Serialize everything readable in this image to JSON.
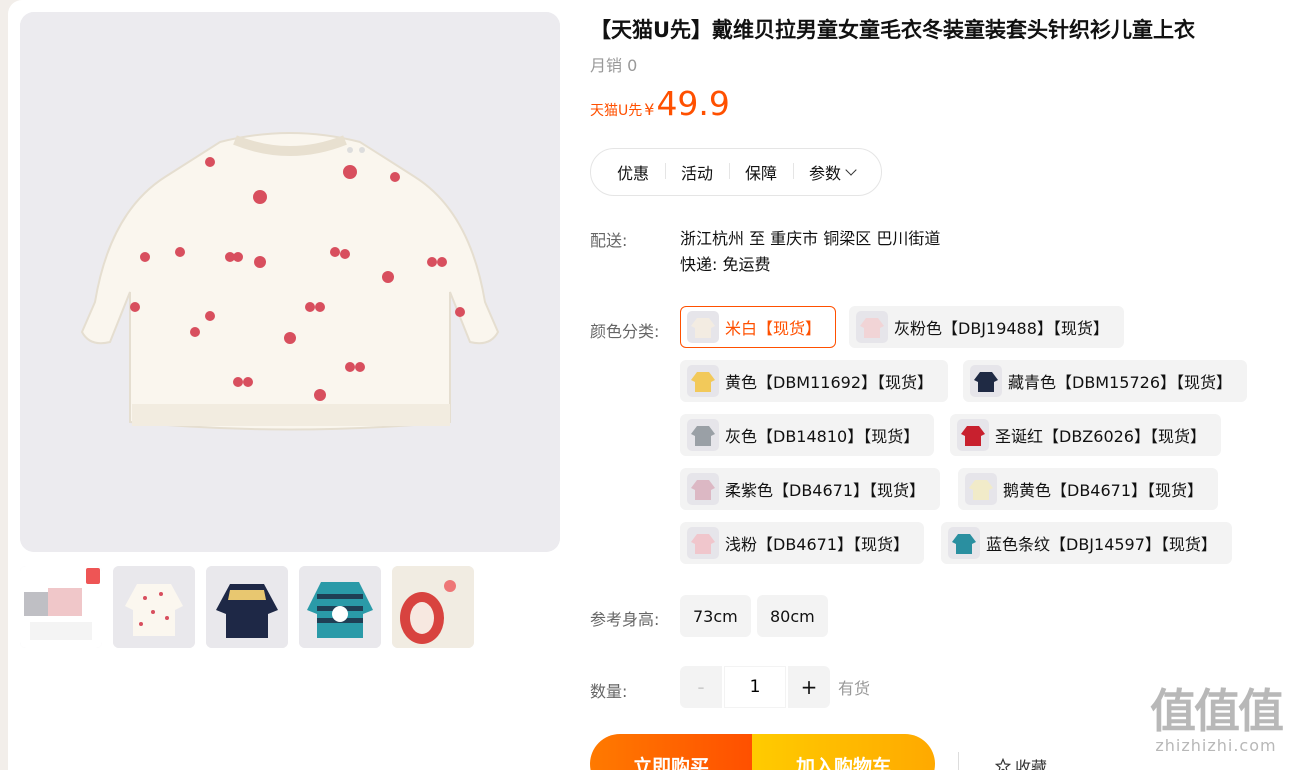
{
  "product": {
    "title": "【天猫U先】戴维贝拉男童女童毛衣冬装童装套头针织衫儿童上衣",
    "sales": "月销 0",
    "price_tag": "天猫U先",
    "currency": "¥",
    "price": "49.9"
  },
  "tabs": [
    {
      "label": "优惠"
    },
    {
      "label": "活动"
    },
    {
      "label": "保障"
    },
    {
      "label": "参数"
    }
  ],
  "shipping": {
    "label": "配送:",
    "route": "浙江杭州 至 重庆市 铜梁区 巴川街道",
    "express": "快递: 免运费"
  },
  "color": {
    "label": "颜色分类:",
    "options": [
      {
        "label": "米白【现货】",
        "swatch": "#f3ece2",
        "selected": true
      },
      {
        "label": "灰粉色【DBJ19488】【现货】",
        "swatch": "#f1d4d6"
      },
      {
        "label": "黄色【DBM11692】【现货】",
        "swatch": "#f2c95a"
      },
      {
        "label": "藏青色【DBM15726】【现货】",
        "swatch": "#1f2a44"
      },
      {
        "label": "灰色【DB14810】【现货】",
        "swatch": "#9aa0a6"
      },
      {
        "label": "圣诞红【DBZ6026】【现货】",
        "swatch": "#c8202e"
      },
      {
        "label": "柔紫色【DB4671】【现货】",
        "swatch": "#dcb8c4"
      },
      {
        "label": "鹅黄色【DB4671】【现货】",
        "swatch": "#f1ebc9"
      },
      {
        "label": "浅粉【DB4671】【现货】",
        "swatch": "#f0c6cc"
      },
      {
        "label": "蓝色条纹【DBJ14597】【现货】",
        "swatch": "#2a8fa0"
      }
    ]
  },
  "size": {
    "label": "参考身高:",
    "options": [
      "73cm",
      "80cm"
    ]
  },
  "quantity": {
    "label": "数量:",
    "minus": "-",
    "plus": "+",
    "value": "1",
    "stock": "有货"
  },
  "actions": {
    "buy_now": "立即购买",
    "add_cart": "加入购物车",
    "favorite": "收藏"
  },
  "watermark": {
    "big": "值值值",
    "small": "zhizhizhi.com"
  },
  "colors": {
    "accent": "#ff5000",
    "cart": "#ffb400"
  }
}
